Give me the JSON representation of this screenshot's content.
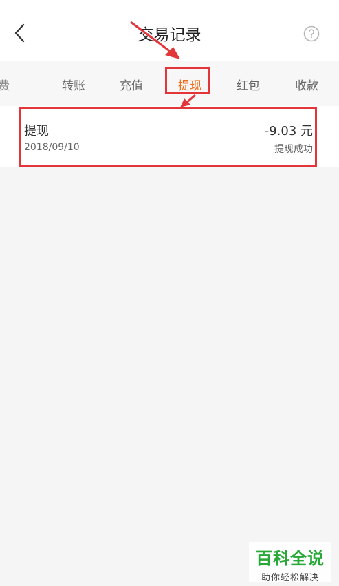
{
  "header": {
    "title": "交易记录"
  },
  "tabs": [
    {
      "label": "转账"
    },
    {
      "label": "充值"
    },
    {
      "label": "提现"
    },
    {
      "label": "红包"
    },
    {
      "label": "收款"
    }
  ],
  "active_tab": "提现",
  "record": {
    "type": "提现",
    "amount": "-9.03 元",
    "date": "2018/09/10",
    "status": "提现成功"
  },
  "watermark": {
    "main": "百科全说",
    "sub": "助你轻松解决"
  },
  "colors": {
    "accent": "#ef6c1a",
    "highlight": "#e3363b",
    "watermark": "#28a836"
  }
}
